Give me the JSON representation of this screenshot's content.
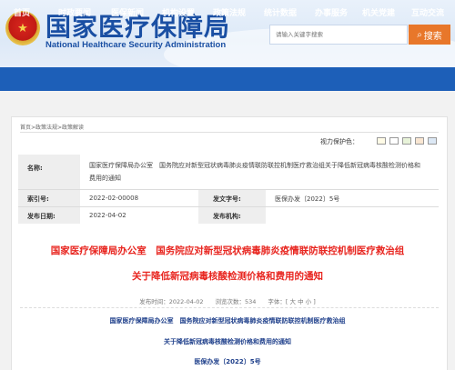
{
  "header": {
    "title_cn": "国家医疗保障局",
    "title_en": "National Healthcare Security Administration",
    "search_placeholder": "请输入关键字搜索",
    "search_button": "搜索"
  },
  "nav": {
    "items": [
      "首页",
      "时政要闻",
      "医保新闻",
      "机构设置",
      "政策法规",
      "统计数据",
      "办事服务",
      "机关党建",
      "互动交流"
    ]
  },
  "breadcrumb": "首页>政策法规>政策解读",
  "vision": {
    "label": "视力保护色：",
    "swatches": [
      "#fffbe6",
      "#ffffff",
      "#e8f3d9",
      "#f9e6d2",
      "#dce8f5"
    ]
  },
  "info": {
    "name_label": "名称:",
    "name_value": "国家医疗保障局办公室　国务院应对新型冠状病毒肺炎疫情联防联控机制医疗救治组关于降低新冠病毒核酸检测价格和费用的通知",
    "index_label": "索引号:",
    "index_value": "2022-02-00008",
    "doc_label": "发文字号:",
    "doc_value": "医保办发〔2022〕5号",
    "date_label": "发布日期:",
    "date_value": "2022-04-02",
    "org_label": "发布机构:",
    "org_value": ""
  },
  "article": {
    "title_line1": "国家医疗保障局办公室　国务院应对新型冠状病毒肺炎疫情联防联控机制医疗救治组",
    "title_line2": "关于降低新冠病毒核酸检测价格和费用的通知",
    "meta": "发布时间：2022-04-02　　浏览次数：534　　字体：[ 大 中 小 ]",
    "body_line1": "国家医疗保障局办公室　国务院应对新型冠状病毒肺炎疫情联防联控机制医疗救治组",
    "body_line2": "关于降低新冠病毒核酸检测价格和费用的通知",
    "body_line3": "医保办发〔2022〕5号"
  }
}
